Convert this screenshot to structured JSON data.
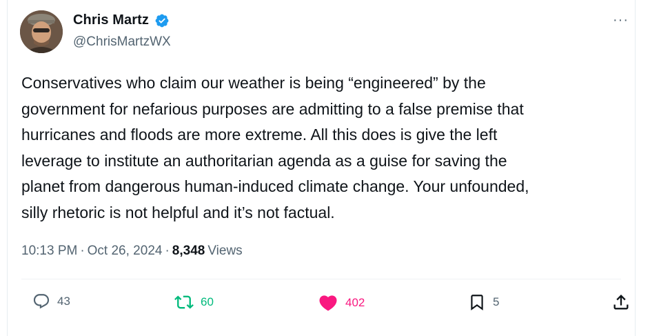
{
  "author": {
    "display_name": "Chris Martz",
    "handle": "@ChrisMartzWX",
    "verified": true
  },
  "more_label": "···",
  "tweet": {
    "text": "Conservatives who claim our weather is being “engineered” by the\ngovernment for nefarious purposes are admitting to a false premise that\nhurricanes and floods are more extreme. All this does is give the left\nleverage to institute an authoritarian agenda as a guise for saving the\nplanet from dangerous human-induced climate change. Your unfounded,\nsilly rhetoric is not helpful and it’s not factual."
  },
  "meta": {
    "time": "10:13 PM",
    "separator": "·",
    "date": "Oct 26, 2024",
    "separator2": "·",
    "views_count": "8,348",
    "views_label": "Views"
  },
  "actions": {
    "reply": {
      "icon": "reply-icon",
      "count": "43"
    },
    "retweet": {
      "icon": "retweet-icon",
      "count": "60",
      "color": "#00ba7c"
    },
    "like": {
      "icon": "heart-icon",
      "count": "402",
      "color": "#f91880"
    },
    "bookmark": {
      "icon": "bookmark-icon",
      "count": "5"
    },
    "share": {
      "icon": "share-icon"
    }
  },
  "colors": {
    "verified": "#1d9bf0",
    "secondary_text": "#536471",
    "primary_text": "#0f1419"
  }
}
